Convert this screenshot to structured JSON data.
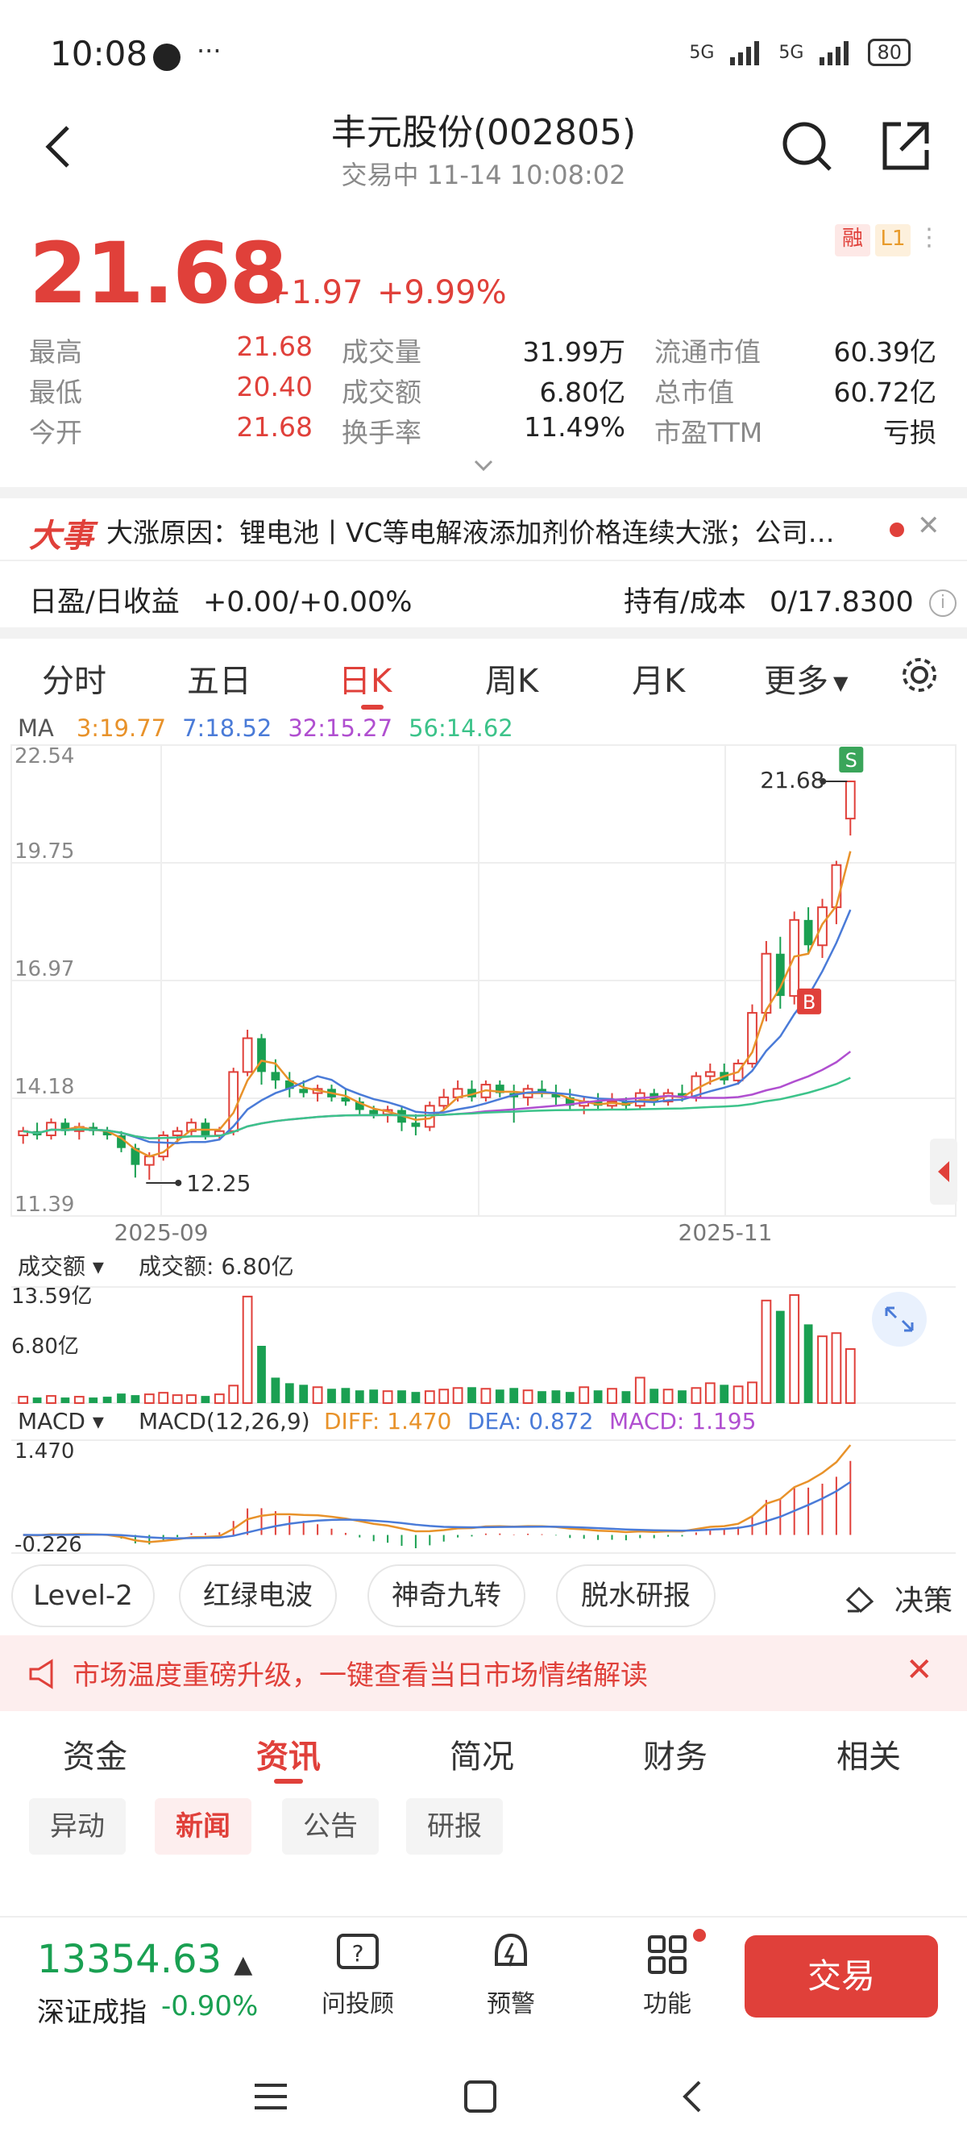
{
  "status": {
    "time": "10:08",
    "extra": "···",
    "net1": "5G",
    "net2": "5G",
    "battery": "80"
  },
  "header": {
    "title": "丰元股份(002805)",
    "subtitle": "交易中  11-14  10:08:02"
  },
  "quote": {
    "price": "21.68",
    "change": "+1.97",
    "change_pct": "+9.99%",
    "tag_margin": "融",
    "tag_level": "L1",
    "stats": [
      {
        "label": "最高",
        "value": "21.68",
        "red": true
      },
      {
        "label": "成交量",
        "value": "31.99万",
        "red": false
      },
      {
        "label": "流通市值",
        "value": "60.39亿",
        "red": false
      },
      {
        "label": "最低",
        "value": "20.40",
        "red": true
      },
      {
        "label": "成交额",
        "value": "6.80亿",
        "red": false
      },
      {
        "label": "总市值",
        "value": "60.72亿",
        "red": false
      },
      {
        "label": "今开",
        "value": "21.68",
        "red": true
      },
      {
        "label": "换手率",
        "value": "11.49%",
        "red": false
      },
      {
        "label": "市盈TTM",
        "value": "亏损",
        "red": false
      }
    ]
  },
  "news": {
    "badge": "大事",
    "text": "大涨原因：锂电池丨VC等电解液添加剂价格连续大涨；公司…"
  },
  "profit": {
    "label": "日盈/日收益",
    "value": "+0.00/+0.00%",
    "hold_label": "持有/成本",
    "hold_value": "0/17.8300"
  },
  "chart_tabs": [
    "分时",
    "五日",
    "日K",
    "周K",
    "月K",
    "更多"
  ],
  "active_chart_tab": "日K",
  "ma": {
    "label": "MA",
    "items": [
      {
        "text": "3:19.77",
        "color": "#e8922a"
      },
      {
        "text": "7:18.52",
        "color": "#4a7bd8"
      },
      {
        "text": "32:15.27",
        "color": "#b04fd0"
      },
      {
        "text": "56:14.62",
        "color": "#3cc38a"
      }
    ]
  },
  "chart_labels": {
    "y_top": "22.54",
    "y_2": "19.75",
    "y_3": "16.97",
    "y_4": "14.18",
    "y_bottom": "11.39",
    "x_1": "2025-09",
    "x_2": "2025-11",
    "high_label": "21.68",
    "low_label": "12.25",
    "sell_marker": "S",
    "buy_marker": "B",
    "vol_title": "成交额",
    "vol_value_label": "成交额: 6.80亿",
    "vol_max": "13.59亿",
    "vol_mid": "6.80亿",
    "macd_title": "MACD",
    "macd_params": "MACD(12,26,9)",
    "macd_diff": "DIFF: 1.470",
    "macd_dea": "DEA: 0.872",
    "macd_macd": "MACD: 1.195",
    "macd_top": "1.470",
    "macd_bottom": "-0.226"
  },
  "chart_data": {
    "type": "candlestick",
    "ylim": [
      11.39,
      22.54
    ],
    "x_ticks": [
      "2025-09",
      "2025-11"
    ],
    "candles": [
      [
        13.3,
        13.5,
        13.1,
        13.4
      ],
      [
        13.4,
        13.6,
        13.2,
        13.3
      ],
      [
        13.3,
        13.7,
        13.2,
        13.6
      ],
      [
        13.6,
        13.7,
        13.3,
        13.4
      ],
      [
        13.4,
        13.6,
        13.2,
        13.5
      ],
      [
        13.5,
        13.6,
        13.3,
        13.4
      ],
      [
        13.4,
        13.5,
        13.2,
        13.3
      ],
      [
        13.3,
        13.4,
        12.9,
        13.0
      ],
      [
        13.0,
        13.1,
        12.3,
        12.6
      ],
      [
        12.6,
        12.9,
        12.25,
        12.8
      ],
      [
        12.8,
        13.4,
        12.7,
        13.3
      ],
      [
        13.3,
        13.5,
        13.1,
        13.4
      ],
      [
        13.4,
        13.7,
        13.3,
        13.6
      ],
      [
        13.6,
        13.7,
        13.2,
        13.3
      ],
      [
        13.3,
        13.5,
        13.2,
        13.4
      ],
      [
        13.4,
        14.9,
        13.3,
        14.8
      ],
      [
        14.8,
        15.8,
        14.7,
        15.6
      ],
      [
        15.6,
        15.7,
        14.5,
        14.8
      ],
      [
        14.8,
        15.1,
        14.4,
        14.6
      ],
      [
        14.6,
        14.8,
        14.2,
        14.4
      ],
      [
        14.4,
        14.6,
        14.2,
        14.3
      ],
      [
        14.3,
        14.5,
        14.1,
        14.4
      ],
      [
        14.4,
        14.5,
        14.1,
        14.2
      ],
      [
        14.2,
        14.4,
        14.0,
        14.1
      ],
      [
        14.1,
        14.2,
        13.8,
        13.9
      ],
      [
        13.9,
        14.0,
        13.7,
        13.8
      ],
      [
        13.8,
        14.0,
        13.6,
        13.9
      ],
      [
        13.9,
        14.0,
        13.4,
        13.6
      ],
      [
        13.6,
        13.8,
        13.3,
        13.5
      ],
      [
        13.5,
        14.1,
        13.4,
        14.0
      ],
      [
        14.0,
        14.4,
        13.9,
        14.2
      ],
      [
        14.2,
        14.6,
        14.1,
        14.4
      ],
      [
        14.4,
        14.6,
        14.1,
        14.2
      ],
      [
        14.2,
        14.6,
        14.1,
        14.5
      ],
      [
        14.5,
        14.6,
        14.2,
        14.3
      ],
      [
        14.3,
        14.5,
        13.6,
        14.2
      ],
      [
        14.2,
        14.5,
        14.0,
        14.4
      ],
      [
        14.4,
        14.6,
        14.2,
        14.3
      ],
      [
        14.3,
        14.5,
        14.0,
        14.2
      ],
      [
        14.2,
        14.4,
        13.9,
        14.0
      ],
      [
        14.0,
        14.2,
        13.8,
        14.1
      ],
      [
        14.1,
        14.3,
        13.9,
        14.0
      ],
      [
        14.0,
        14.3,
        13.9,
        14.1
      ],
      [
        14.1,
        14.2,
        13.9,
        14.0
      ],
      [
        14.0,
        14.4,
        13.9,
        14.3
      ],
      [
        14.3,
        14.4,
        14.0,
        14.1
      ],
      [
        14.1,
        14.4,
        14.0,
        14.3
      ],
      [
        14.3,
        14.5,
        14.1,
        14.2
      ],
      [
        14.2,
        14.8,
        14.1,
        14.7
      ],
      [
        14.7,
        15.0,
        14.5,
        14.8
      ],
      [
        14.8,
        15.0,
        14.5,
        14.6
      ],
      [
        14.6,
        15.1,
        14.5,
        15.0
      ],
      [
        15.0,
        16.4,
        14.9,
        16.2
      ],
      [
        16.2,
        17.9,
        16.0,
        17.6
      ],
      [
        17.6,
        18.0,
        16.3,
        16.6
      ],
      [
        16.6,
        18.6,
        16.4,
        18.4
      ],
      [
        18.4,
        18.7,
        17.6,
        17.8
      ],
      [
        17.8,
        18.9,
        17.5,
        18.7
      ],
      [
        18.7,
        19.8,
        18.3,
        19.7
      ],
      [
        20.8,
        21.7,
        20.4,
        21.68
      ]
    ],
    "ma": {
      "3": 19.77,
      "7": 18.52,
      "32": 15.27,
      "56": 14.62
    },
    "volume": [
      0.8,
      0.7,
      0.9,
      0.7,
      0.8,
      0.7,
      0.8,
      1.2,
      1.0,
      1.1,
      1.3,
      1.0,
      1.0,
      0.9,
      1.1,
      2.2,
      13.4,
      7.2,
      3.2,
      2.5,
      2.3,
      2.0,
      1.8,
      1.9,
      1.6,
      1.7,
      1.5,
      1.6,
      1.4,
      1.5,
      1.7,
      1.9,
      2.0,
      1.8,
      1.7,
      1.9,
      1.6,
      1.5,
      1.6,
      1.4,
      2.0,
      1.6,
      1.8,
      1.5,
      3.2,
      1.8,
      1.7,
      1.6,
      1.9,
      2.5,
      2.3,
      2.1,
      2.6,
      12.9,
      11.6,
      13.59,
      9.9,
      8.4,
      8.8,
      6.8
    ],
    "volume_ylim": [
      0,
      13.59
    ],
    "macd": {
      "diff": 1.47,
      "dea": 0.872,
      "macd": 1.195
    },
    "macd_ylim": [
      -0.226,
      1.47
    ]
  },
  "indicators": [
    "Level-2",
    "红绿电波",
    "神奇九转",
    "脱水研报"
  ],
  "decision": "决策",
  "alert": {
    "text": "市场温度重磅升级，一键查看当日市场情绪解读"
  },
  "info_tabs": [
    "资金",
    "资讯",
    "简况",
    "财务",
    "相关"
  ],
  "active_info_tab": "资讯",
  "sub_tabs": [
    "异动",
    "新闻",
    "公告",
    "研报"
  ],
  "active_sub_tab": "新闻",
  "bottom": {
    "index_value": "13354.63",
    "index_arrow": "▲",
    "index_name": "深证成指",
    "index_change": "-0.90%",
    "btn_ask": "问投顾",
    "btn_alert": "预警",
    "btn_func": "功能",
    "btn_trade": "交易"
  },
  "colors": {
    "up": "#e0403a",
    "down": "#1aa052",
    "accent": "#e0403a"
  }
}
